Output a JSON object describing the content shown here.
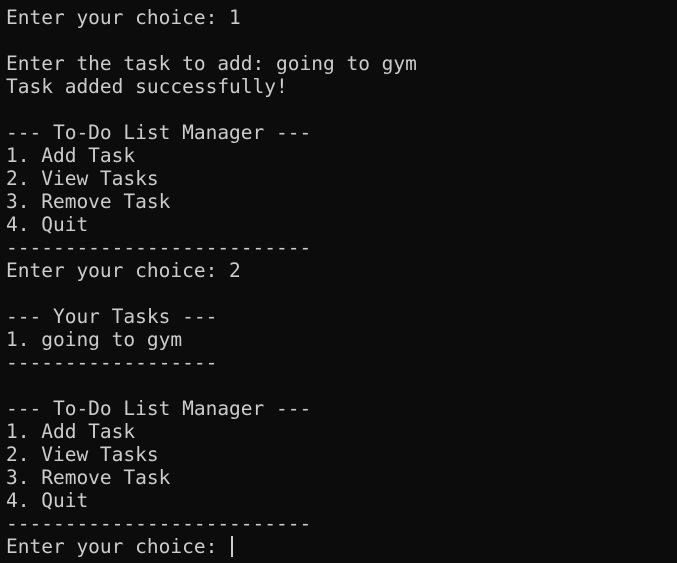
{
  "terminal": {
    "lines": [
      "Enter your choice: 1",
      "",
      "Enter the task to add: going to gym",
      "Task added successfully!",
      "",
      "--- To-Do List Manager ---",
      "1. Add Task",
      "2. View Tasks",
      "3. Remove Task",
      "4. Quit",
      "--------------------------",
      "Enter your choice: 2",
      "",
      "--- Your Tasks ---",
      "1. going to gym",
      "------------------",
      "",
      "--- To-Do List Manager ---",
      "1. Add Task",
      "2. View Tasks",
      "3. Remove Task",
      "4. Quit",
      "--------------------------"
    ],
    "prompt": "Enter your choice: ",
    "input_value": ""
  },
  "colors": {
    "background": "#0c0c0c",
    "foreground": "#cccccc"
  }
}
